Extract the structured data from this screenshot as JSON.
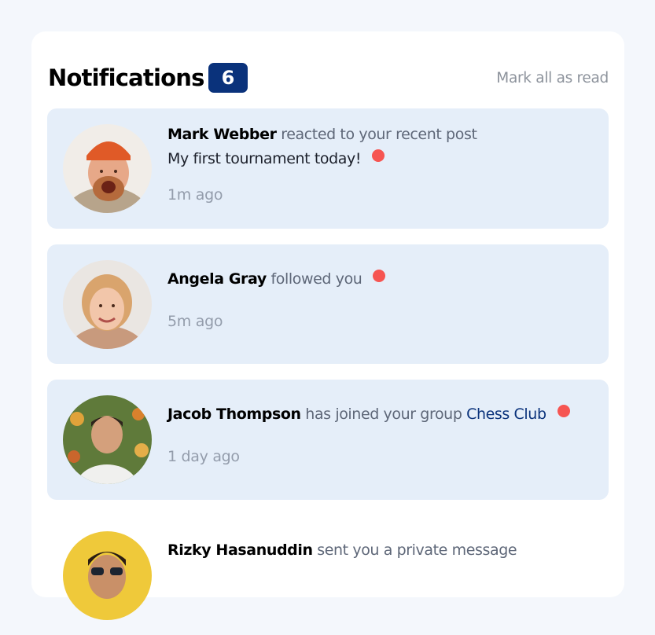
{
  "header": {
    "title": "Notifications",
    "count": "6",
    "mark_all": "Mark all as read"
  },
  "colors": {
    "badge": "#0a327b",
    "unread_bg": "#e5eef9",
    "dot": "#f65552",
    "link": "#0a327b"
  },
  "notifications": [
    {
      "name": "Mark Webber",
      "action": "reacted to your recent post",
      "post": "My first tournament today!",
      "time": "1m ago",
      "unread": true
    },
    {
      "name": "Angela Gray",
      "action": "followed you",
      "time": "5m ago",
      "unread": true
    },
    {
      "name": "Jacob Thompson",
      "action": "has joined your group",
      "group": "Chess Club",
      "time": "1 day ago",
      "unread": true
    },
    {
      "name": "Rizky Hasanuddin",
      "action": "sent you a private message",
      "unread": false
    }
  ]
}
